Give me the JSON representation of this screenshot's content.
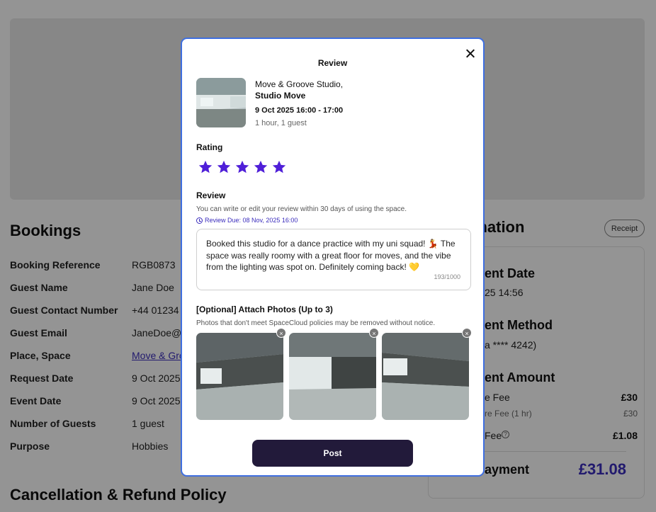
{
  "bookings": {
    "title": "Bookings",
    "rows": [
      {
        "label": "Booking Reference",
        "value": "RGB0873"
      },
      {
        "label": "Guest Name",
        "value": "Jane Doe"
      },
      {
        "label": "Guest Contact Number",
        "value": "+44 01234"
      },
      {
        "label": "Guest Email",
        "value": "JaneDoe@"
      },
      {
        "label": "Place, Space",
        "value": "Move & Gro"
      },
      {
        "label": "Request Date",
        "value": "9 Oct 2025"
      },
      {
        "label": "Event Date",
        "value": "9 Oct 2025"
      },
      {
        "label": "Number of Guests",
        "value": "1 guest"
      },
      {
        "label": "Purpose",
        "value": "Hobbies"
      }
    ],
    "cancellation_title": "Cancellation & Refund Policy"
  },
  "payment": {
    "title": "t Information",
    "receipt_label": "Receipt",
    "date_heading": "ent Date",
    "date_value": "25 14:56",
    "method_heading": "ent Method",
    "method_value": "a **** 4242)",
    "amount_heading": "ent Amount",
    "fee_label": "e Fee",
    "fee_value": "£30",
    "hire_label": "re Fee (1 hr)",
    "hire_value": "£30",
    "service_label": "Fee",
    "service_value": "£1.08",
    "total_label": "ayment",
    "total_value": "£31.08"
  },
  "modal": {
    "title": "Review",
    "venue": "Move & Groove Studio,",
    "space": "Studio Move",
    "datetime": "9 Oct 2025 16:00 - 17:00",
    "duration": "1 hour,  1 guest",
    "rating_label": "Rating",
    "rating": 5,
    "review_label": "Review",
    "review_hint": "You can write or edit your review within 30 days of using the space.",
    "review_due": "Review Due: 08 Nov, 2025 16:00",
    "review_text": "Booked this studio for a dance practice with my uni squad! 💃 The space was really roomy with a great floor for moves, and the vibe from the lighting was spot on. Definitely coming back! 💛",
    "char_count": "193/1000",
    "photos_label": "[Optional] Attach Photos (Up to 3)",
    "photos_hint": "Photos that don't meet SpaceCloud policies may be removed without notice.",
    "remove_symbol": "×",
    "post_label": "Post"
  },
  "colors": {
    "accent": "#3b2dbd",
    "star": "#4f1fd8",
    "post_button": "#221a3a",
    "modal_border": "#3f6fe0"
  }
}
